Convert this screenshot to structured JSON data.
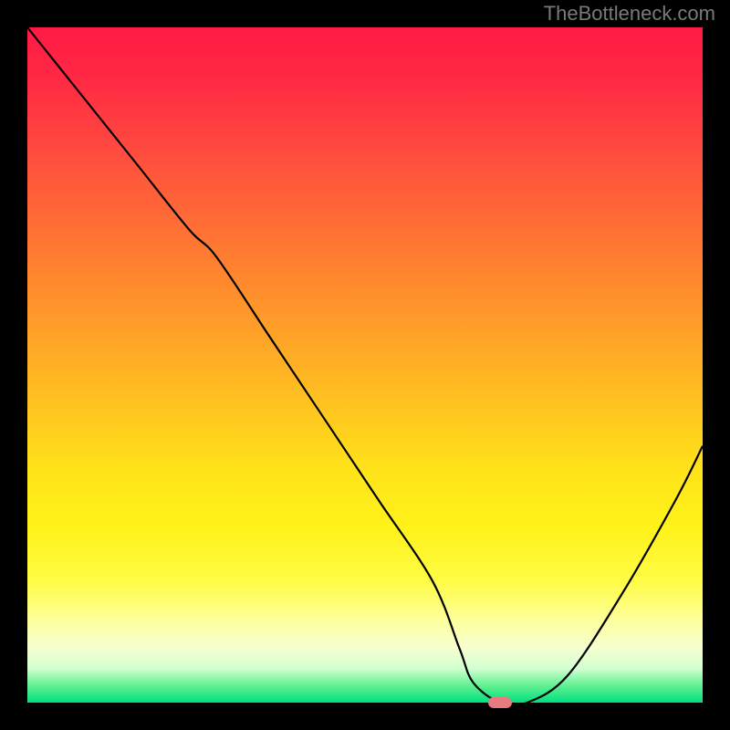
{
  "watermark": "TheBottleneck.com",
  "chart_data": {
    "type": "line",
    "title": "",
    "xlabel": "",
    "ylabel": "",
    "xlim": [
      0,
      100
    ],
    "ylim": [
      0,
      100
    ],
    "grid": false,
    "legend": false,
    "background": "red-yellow-green vertical gradient (red top, green bottom)",
    "series": [
      {
        "name": "bottleneck-curve",
        "x": [
          0,
          8,
          16,
          24,
          28,
          36,
          44,
          52,
          60,
          64,
          66,
          70,
          74,
          80,
          88,
          96,
          100
        ],
        "y": [
          100,
          90,
          80,
          70,
          66,
          54,
          42,
          30,
          18,
          8,
          3,
          0,
          0,
          4,
          16,
          30,
          38
        ]
      }
    ],
    "marker": {
      "x": 70,
      "y": 0,
      "color": "#e77a7f"
    }
  }
}
